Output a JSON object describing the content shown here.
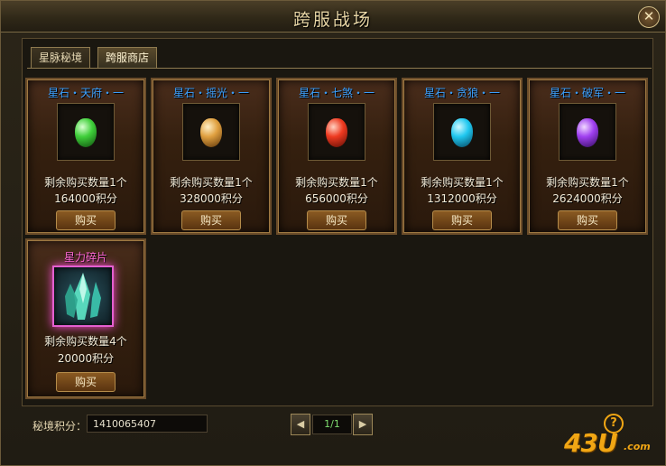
{
  "window": {
    "title": "跨服战场",
    "close_label": "✕"
  },
  "tabs": [
    {
      "label": "星脉秘境",
      "active": false
    },
    {
      "label": "跨服商店",
      "active": true
    }
  ],
  "items": [
    {
      "name": "星石・天府・一",
      "gem_color": "#3fcf3a",
      "remaining": "剩余购买数量1个",
      "price": "164000积分",
      "buy_label": "购买"
    },
    {
      "name": "星石・摇光・一",
      "gem_color": "#e0a040",
      "remaining": "剩余购买数量1个",
      "price": "328000积分",
      "buy_label": "购买"
    },
    {
      "name": "星石・七煞・一",
      "gem_color": "#ee3a20",
      "remaining": "剩余购买数量1个",
      "price": "656000积分",
      "buy_label": "购买"
    },
    {
      "name": "星石・贪狼・一",
      "gem_color": "#20c8f0",
      "remaining": "剩余购买数量1个",
      "price": "1312000积分",
      "buy_label": "购买"
    },
    {
      "name": "星石・破军・一",
      "gem_color": "#a040f0",
      "remaining": "剩余购买数量1个",
      "price": "2624000积分",
      "buy_label": "购买"
    },
    {
      "name": "星力碎片",
      "gem_color": "#4fe0c0",
      "remaining": "剩余购买数量4个",
      "price": "20000积分",
      "buy_label": "购买"
    }
  ],
  "footer": {
    "score_label": "秘境积分：",
    "score_value": "1410065407",
    "page_indicator": "1/1",
    "prev_label": "◀",
    "next_label": "▶"
  },
  "logo": {
    "text": "43U",
    "suffix": ".com",
    "badge": "?"
  }
}
